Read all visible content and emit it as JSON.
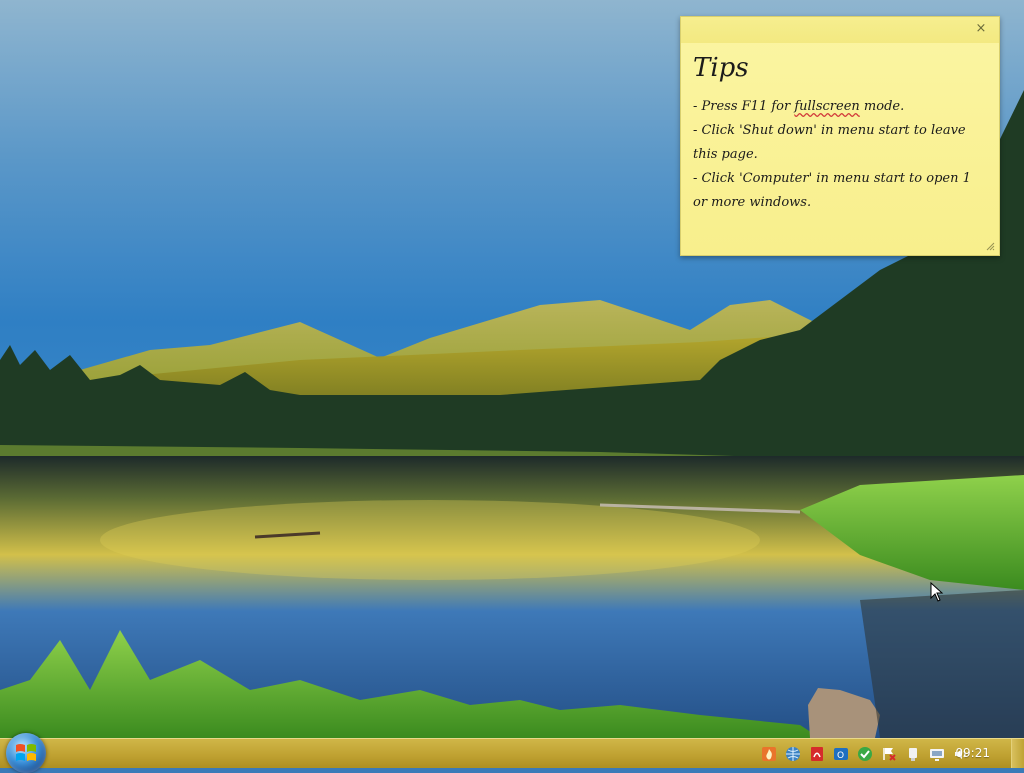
{
  "desktop": {
    "wallpaper": "mountain-lake-landscape"
  },
  "sticky_note": {
    "title": "Tips",
    "tip1_prefix": "- Press F11 for ",
    "tip1_word": "fullscreen",
    "tip1_suffix": " mode.",
    "tip2": "- Click 'Shut down' in menu start to leave this page.",
    "tip3": "- Click 'Computer' in menu start to open 1 or more windows.",
    "close_glyph": "×"
  },
  "taskbar": {
    "clock": "09:21",
    "tray_icons": [
      "fire-icon",
      "network-globe-icon",
      "pdf-icon",
      "outlook-icon",
      "security-check-icon",
      "action-center-flag-icon",
      "usb-device-icon",
      "display-icon",
      "volume-icon"
    ],
    "colors": {
      "accent": "#c0a232",
      "start_orb": "#3b8fd8"
    }
  }
}
